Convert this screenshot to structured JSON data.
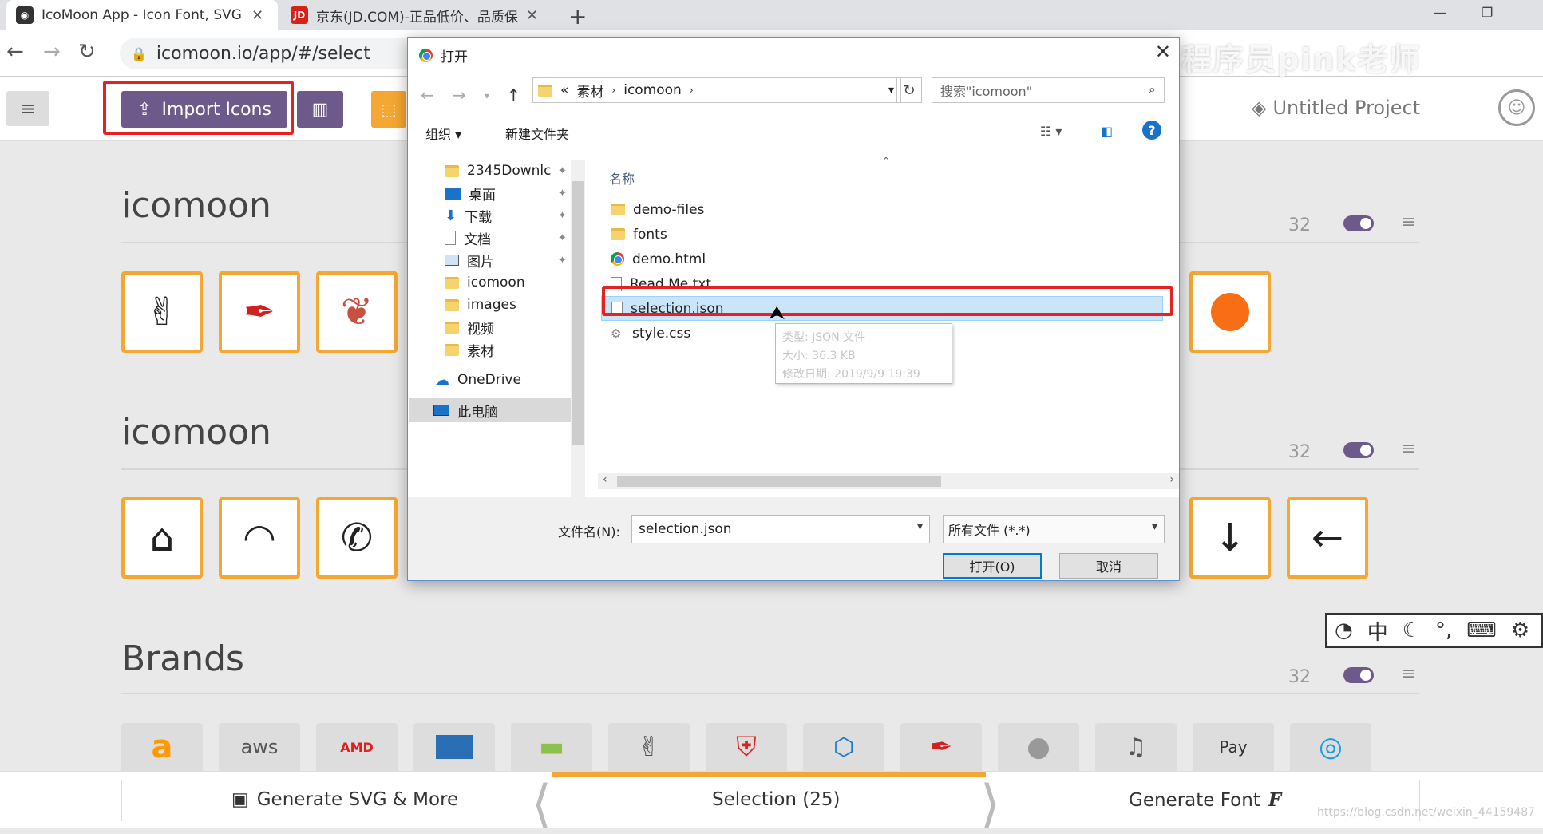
{
  "browser": {
    "tabs": [
      {
        "title": "IcoMoon App - Icon Font, SVG",
        "favicon": "icomoon-favicon"
      },
      {
        "title": "京东(JD.COM)-正品低价、品质保",
        "favicon": "JD"
      }
    ],
    "url": "icomoon.io/app/#/select"
  },
  "watermark": "黑马程序员pink老师",
  "app": {
    "import_label": "Import Icons",
    "project_name": "Untitled Project",
    "sets": [
      {
        "title": "icomoon",
        "count": "32",
        "icons": [
          "victory-hand",
          "quill",
          "hot-air-balloon",
          "circle"
        ]
      },
      {
        "title": "icomoon",
        "count": "32",
        "icons": [
          "home",
          "wifi",
          "phone",
          "arrow-down",
          "arrow-left"
        ]
      },
      {
        "title": "Brands",
        "count": "32",
        "icons": [
          "amazon",
          "aws",
          "amd",
          "amex",
          "android",
          "angellist",
          "angular",
          "appveyor",
          "quill",
          "apple",
          "itunes",
          "applepay",
          "artstation"
        ]
      }
    ],
    "brand_texts": {
      "amazon": "a",
      "aws": "aws",
      "amd": "AMD",
      "applepay": " Pay"
    },
    "footer": {
      "generate_svg": "Generate SVG & More",
      "selection": "Selection (25)",
      "generate_font": "Generate Font"
    },
    "blog_mark": "https://blog.csdn.net/weixin_44159487"
  },
  "ime_bar": {
    "mode": "中"
  },
  "dialog": {
    "title": "打开",
    "path": [
      "«",
      "素材",
      "icomoon"
    ],
    "search_placeholder": "搜索\"icomoon\"",
    "toolbar": {
      "organize": "组织 ▾",
      "new_folder": "新建文件夹"
    },
    "nav": [
      {
        "label": "2345Downlc",
        "icon": "folder",
        "pinned": true
      },
      {
        "label": "桌面",
        "icon": "desktop",
        "pinned": true
      },
      {
        "label": "下载",
        "icon": "download",
        "pinned": true
      },
      {
        "label": "文档",
        "icon": "document",
        "pinned": true
      },
      {
        "label": "图片",
        "icon": "picture",
        "pinned": true
      },
      {
        "label": "icomoon",
        "icon": "folder",
        "pinned": false
      },
      {
        "label": "images",
        "icon": "folder",
        "pinned": false
      },
      {
        "label": "视频",
        "icon": "folder",
        "pinned": false
      },
      {
        "label": "素材",
        "icon": "folder",
        "pinned": false
      },
      {
        "label": "OneDrive",
        "icon": "cloud",
        "pinned": false
      },
      {
        "label": "此电脑",
        "icon": "computer",
        "pinned": false
      }
    ],
    "column_name": "名称",
    "files": [
      {
        "name": "demo-files",
        "type": "folder"
      },
      {
        "name": "fonts",
        "type": "folder"
      },
      {
        "name": "demo.html",
        "type": "chrome"
      },
      {
        "name": "Read Me.txt",
        "type": "text"
      },
      {
        "name": "selection.json",
        "type": "json",
        "selected": true
      },
      {
        "name": "style.css",
        "type": "css"
      }
    ],
    "tooltip": [
      "类型: JSON 文件",
      "大小: 36.3 KB",
      "修改日期: 2019/9/9 19:39"
    ],
    "filename_label": "文件名(N):",
    "filename_value": "selection.json",
    "filetype": "所有文件 (*.*)",
    "open_label": "打开(O)",
    "cancel_label": "取消"
  }
}
